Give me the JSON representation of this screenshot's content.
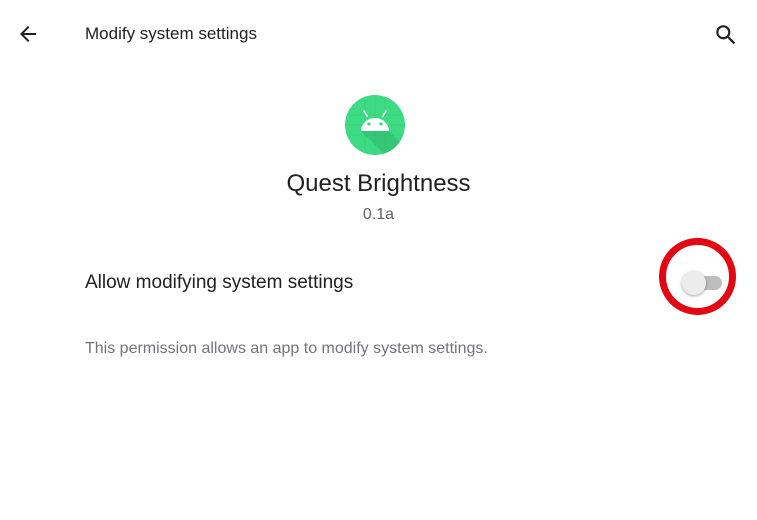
{
  "header": {
    "title": "Modify system settings",
    "back_icon": "arrow-back-icon",
    "search_icon": "search-icon"
  },
  "app": {
    "name": "Quest Brightness",
    "version": "0.1a",
    "icon": "android-robot-icon",
    "icon_color": "#3ddc84"
  },
  "setting": {
    "label": "Allow modifying system settings",
    "enabled": false,
    "description": "This permission allows an app to modify system settings."
  },
  "annotation": {
    "highlight_color": "#e30613"
  }
}
